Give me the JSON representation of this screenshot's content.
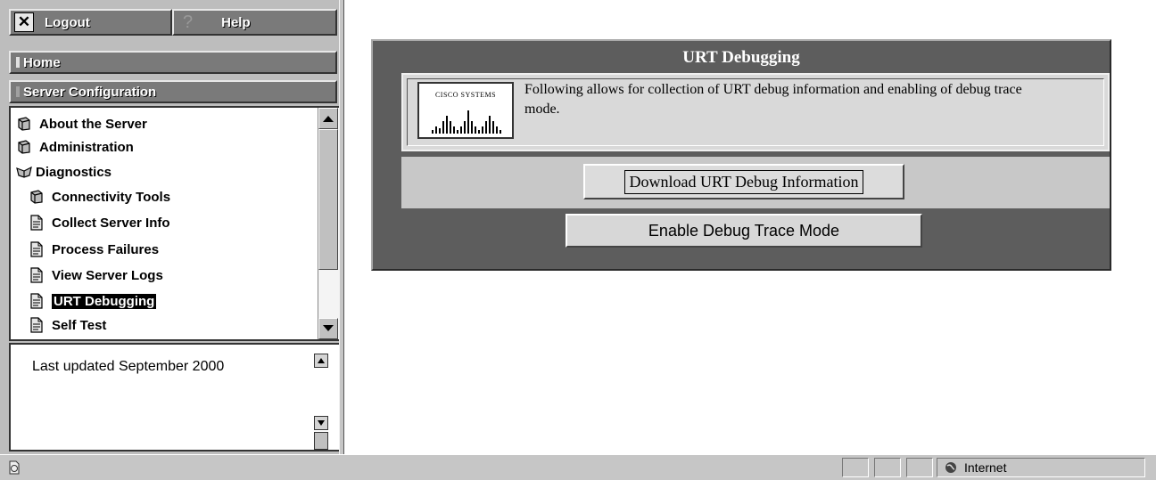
{
  "toolbar": {
    "logout_label": "Logout",
    "help_label": "Help"
  },
  "nav": {
    "home_label": "Home",
    "server_config_label": "Server Configuration"
  },
  "tree": {
    "items": [
      {
        "label": "About the Server",
        "icon": "book-closed-icon"
      },
      {
        "label": "Administration",
        "icon": "book-closed-icon"
      },
      {
        "label": "Diagnostics",
        "icon": "book-open-icon"
      },
      {
        "label": "Connectivity Tools",
        "icon": "book-closed-icon"
      },
      {
        "label": "Collect Server Info",
        "icon": "page-icon"
      },
      {
        "label": "Process Failures",
        "icon": "page-icon"
      },
      {
        "label": "View Server Logs",
        "icon": "page-icon"
      },
      {
        "label": "URT Debugging",
        "icon": "page-icon",
        "selected": true
      },
      {
        "label": "Self Test",
        "icon": "page-icon"
      }
    ]
  },
  "note": {
    "text": "Last updated September 2000"
  },
  "main": {
    "title": "URT Debugging",
    "logo_text": "CISCO SYSTEMS",
    "description": "Following allows for collection of URT debug information and enabling of debug trace mode.",
    "download_label": "Download URT Debug Information",
    "trace_label": "Enable Debug Trace Mode"
  },
  "status": {
    "zone_label": "Internet"
  }
}
